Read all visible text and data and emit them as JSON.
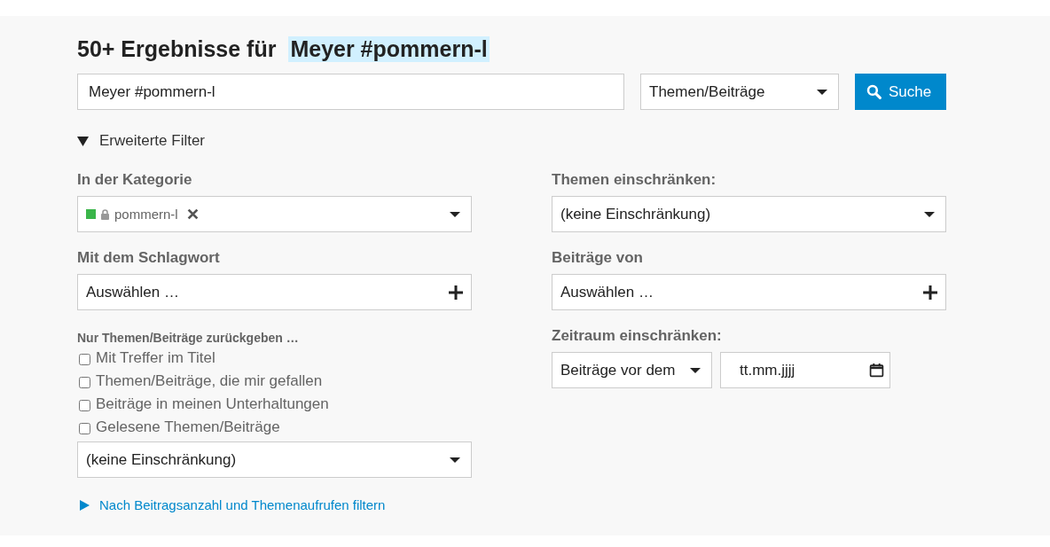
{
  "heading": {
    "prefix": "50+ Ergebnisse für",
    "query": "Meyer #pommern-l"
  },
  "search": {
    "value": "Meyer #pommern-l",
    "scope": "Themen/Beiträge",
    "button": "Suche"
  },
  "advanced_filters": {
    "label": "Erweiterte Filter",
    "expanded": true
  },
  "left": {
    "category": {
      "label": "In der Kategorie",
      "tag": {
        "name": "pommern-l",
        "color": "#3ab54a",
        "locked": true
      }
    },
    "tags": {
      "label": "Mit dem Schlagwort",
      "placeholder": "Auswählen …"
    },
    "only_return": {
      "label": "Nur Themen/Beiträge zurückgeben …",
      "options": [
        {
          "label": "Mit Treffer im Titel",
          "checked": false
        },
        {
          "label": "Themen/Beiträge, die mir gefallen",
          "checked": false
        },
        {
          "label": "Beiträge in meinen Unterhaltungen",
          "checked": false
        },
        {
          "label": "Gelesene Themen/Beiträge",
          "checked": false
        }
      ],
      "select": "(keine Einschränkung)"
    },
    "more_filters": {
      "label": "Nach Beitragsanzahl und Themenaufrufen filtern",
      "expanded": false
    }
  },
  "right": {
    "topics": {
      "label": "Themen einschränken:",
      "select": "(keine Einschränkung)"
    },
    "posted_by": {
      "label": "Beiträge von",
      "placeholder": "Auswählen …"
    },
    "period": {
      "label": "Zeitraum einschränken:",
      "select": "Beiträge vor dem",
      "date_placeholder": "tt.mm.jjjj"
    }
  }
}
